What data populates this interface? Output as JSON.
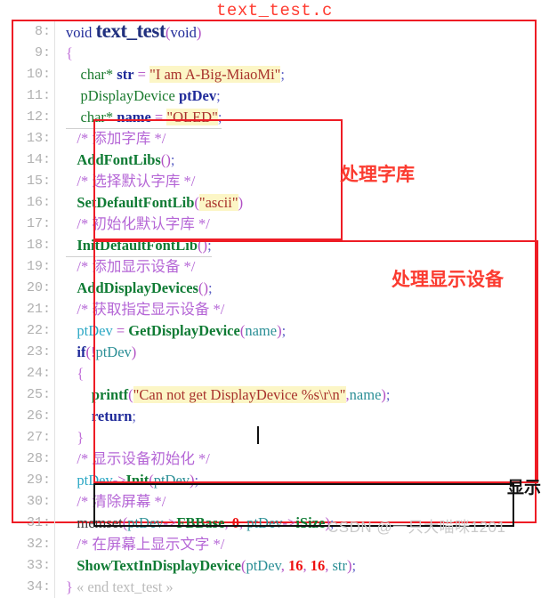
{
  "title": "text_test.c",
  "watermark": "CSDN @一只大喵咪1201",
  "annotations": {
    "font_lib_label": "处理字库",
    "display_device_label": "处理显示设备",
    "show_label": "显示"
  },
  "code": {
    "first_line_number": 8,
    "lines": [
      {
        "num": "8:",
        "text": "void text_test(void)"
      },
      {
        "num": "9:",
        "text": "{"
      },
      {
        "num": "10:",
        "text": "    char* str = \"I am A-Big-MiaoMi\";"
      },
      {
        "num": "11:",
        "text": "    pDisplayDevice ptDev;"
      },
      {
        "num": "12:",
        "text": "    char* name = \"OLED\";"
      },
      {
        "num": "13:",
        "text": "    /* 添加字库 */"
      },
      {
        "num": "14:",
        "text": "    AddFontLibs();"
      },
      {
        "num": "15:",
        "text": "    /* 选择默认字库 */"
      },
      {
        "num": "16:",
        "text": "    SetDefaultFontLib(\"ascii\")"
      },
      {
        "num": "17:",
        "text": "    /* 初始化默认字库 */"
      },
      {
        "num": "18:",
        "text": "    InitDefaultFontLib();"
      },
      {
        "num": "19:",
        "text": "    /* 添加显示设备 */"
      },
      {
        "num": "20:",
        "text": "    AddDisplayDevices();"
      },
      {
        "num": "21:",
        "text": "    /* 获取指定显示设备 */"
      },
      {
        "num": "22:",
        "text": "    ptDev = GetDisplayDevice(name);"
      },
      {
        "num": "23:",
        "text": "    if(!ptDev)"
      },
      {
        "num": "24:",
        "text": "    {"
      },
      {
        "num": "25:",
        "text": "        printf(\"Can not get DisplayDevice %s\\r\\n\",name);"
      },
      {
        "num": "26:",
        "text": "        return;"
      },
      {
        "num": "27:",
        "text": "    }"
      },
      {
        "num": "28:",
        "text": "    /* 显示设备初始化 */"
      },
      {
        "num": "29:",
        "text": "    ptDev->Init(ptDev);"
      },
      {
        "num": "30:",
        "text": "    /* 清除屏幕 */"
      },
      {
        "num": "31:",
        "text": "    memset(ptDev->FBBase, 0, ptDev->iSize);"
      },
      {
        "num": "32:",
        "text": "    /* 在屏幕上显示文字 */"
      },
      {
        "num": "33:",
        "text": "    ShowTextInDisplayDevice(ptDev, 16, 16, str);"
      },
      {
        "num": "34:",
        "text": "} « end text_test »"
      }
    ],
    "tokens": {
      "line8": {
        "kw_void": "void",
        "fn_name": "text_test",
        "paren_open": "(",
        "arg_void": "void",
        "paren_close": ")"
      },
      "line9": {
        "brace": "{"
      },
      "line10": {
        "type": "char*",
        "var": "str",
        "op": "=",
        "string": "\"I am A-Big-MiaoMi\"",
        "semi": ";"
      },
      "line11": {
        "type": "pDisplayDevice",
        "var": "ptDev",
        "semi": ";"
      },
      "line12": {
        "type": "char*",
        "var": "name",
        "op": "=",
        "string": "\"OLED\"",
        "semi": ";"
      },
      "line13": {
        "comment": "/* 添加字库 */"
      },
      "line14": {
        "fn": "AddFontLibs",
        "parens": "()",
        "semi": ";"
      },
      "line15": {
        "comment": "/* 选择默认字库 */"
      },
      "line16": {
        "fn": "SetDefaultFontLib",
        "paren_open": "(",
        "string": "\"ascii\"",
        "paren_close": ")"
      },
      "line17": {
        "comment": "/* 初始化默认字库 */"
      },
      "line18": {
        "fn": "InitDefaultFontLib",
        "parens": "()",
        "semi": ";"
      },
      "line19": {
        "comment": "/* 添加显示设备 */"
      },
      "line20": {
        "fn": "AddDisplayDevices",
        "parens": "()",
        "semi": ";"
      },
      "line21": {
        "comment": "/* 获取指定显示设备 */"
      },
      "line22": {
        "var": "ptDev",
        "op": "=",
        "fn": "GetDisplayDevice",
        "paren_open": "(",
        "arg": "name",
        "paren_close": ")",
        "semi": ";"
      },
      "line23": {
        "kw": "if",
        "paren_open": "(",
        "op": "!",
        "arg": "ptDev",
        "paren_close": ")"
      },
      "line24": {
        "brace": "{"
      },
      "line25": {
        "fn": "printf",
        "paren_open": "(",
        "string": "\"Can not get DisplayDevice %s\\r\\n\"",
        "comma": ",",
        "arg": "name",
        "paren_close": ")",
        "semi": ";"
      },
      "line26": {
        "kw": "return",
        "semi": ";"
      },
      "line27": {
        "brace": "}"
      },
      "line28": {
        "comment": "/* 显示设备初始化 */"
      },
      "line29": {
        "var": "ptDev",
        "arrow": "->",
        "fn": "Init",
        "paren_open": "(",
        "arg": "ptDev",
        "paren_close": ")",
        "semi": ";"
      },
      "line30": {
        "comment": "/* 清除屏幕 */"
      },
      "line31": {
        "fn": "memset",
        "paren_open": "(",
        "arg1": "ptDev",
        "arrow1": "->",
        "field1": "FBBase",
        "num": "0",
        "arg2": "ptDev",
        "arrow2": "->",
        "field2": "iSize",
        "paren_close": ")",
        "semi": ";"
      },
      "line32": {
        "comment": "/* 在屏幕上显示文字 */"
      },
      "line33": {
        "fn": "ShowTextInDisplayDevice",
        "paren_open": "(",
        "arg1": "ptDev",
        "num1": "16",
        "num2": "16",
        "arg2": "str",
        "paren_close": ")",
        "semi": ";"
      },
      "line34": {
        "brace": "}",
        "fold": "« end text_test »"
      }
    }
  },
  "colors": {
    "frame_red": "#ee1c25",
    "annotation_red": "#fb3b30",
    "string_fg": "#a8322c",
    "string_bg": "#fcf6c6",
    "comment": "#b566d6",
    "function": "#0f7b34",
    "keyword": "#1f2a99",
    "number": "#ee1111",
    "line_number": "#b0b0b0",
    "watermark": "#c9c9c9"
  }
}
